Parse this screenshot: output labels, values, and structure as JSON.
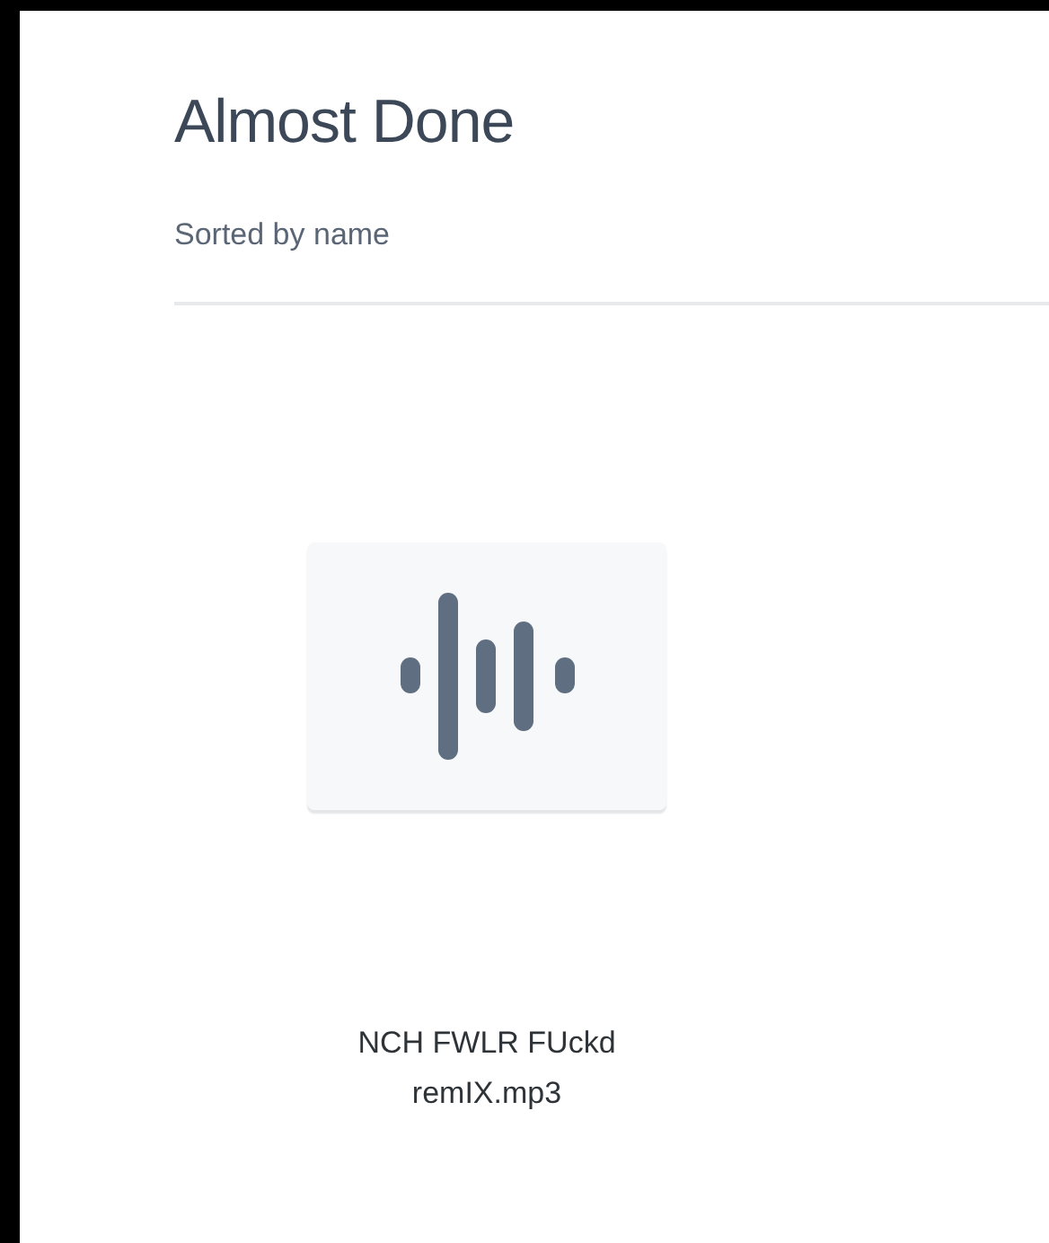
{
  "title": "Almost Done",
  "sort_label": "Sorted by name",
  "files": [
    {
      "name": "NCH FWLR FUckd remIX.mp3",
      "kind": "audio"
    }
  ]
}
